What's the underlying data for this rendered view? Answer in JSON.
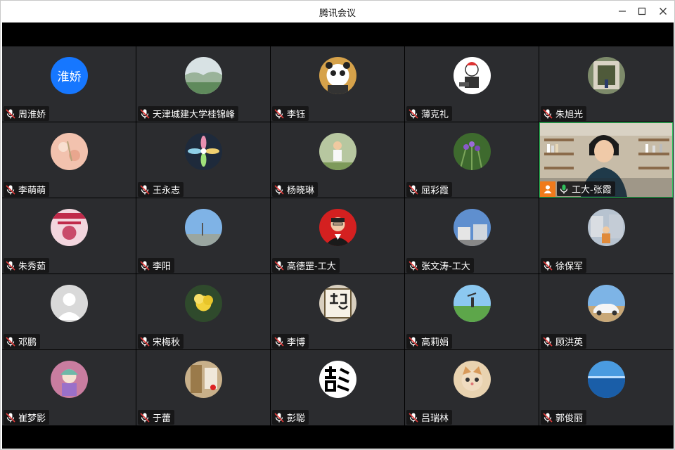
{
  "window": {
    "title": "腾讯会议",
    "minimize": "—",
    "maximize": "☐",
    "close": "✕"
  },
  "participants": [
    {
      "name": "周淮娇",
      "avatar": "text",
      "avatar_text": "淮娇",
      "color": "#1677ff"
    },
    {
      "name": "天津城建大学桂锦峰",
      "avatar": "landscape-lake",
      "color": "#9ab39a"
    },
    {
      "name": "李钰",
      "avatar": "kung-fu-panda",
      "color": "#d6a24a"
    },
    {
      "name": "薄克礼",
      "avatar": "cartoon-figure",
      "color": "#ffffff"
    },
    {
      "name": "朱旭光",
      "avatar": "garden-gate",
      "color": "#7d8a6a"
    },
    {
      "name": "李萌萌",
      "avatar": "floral-pink",
      "color": "#f2c2ae"
    },
    {
      "name": "王永志",
      "avatar": "flower-pattern",
      "color": "#1e2a3b"
    },
    {
      "name": "杨晓琳",
      "avatar": "child-outdoor",
      "color": "#b7c7a0"
    },
    {
      "name": "屈彩霞",
      "avatar": "purple-flowers",
      "color": "#4f7a3a"
    },
    {
      "name": "工大-张霞",
      "avatar": "video",
      "color": "#3a3632",
      "active": true,
      "host": true
    },
    {
      "name": "朱秀茹",
      "avatar": "poster-red",
      "color": "#c94b6a"
    },
    {
      "name": "李阳",
      "avatar": "sky-city",
      "color": "#7fb3e6"
    },
    {
      "name": "高德罡-工大",
      "avatar": "portrait-red",
      "color": "#d42020"
    },
    {
      "name": "张文涛-工大",
      "avatar": "campus-building",
      "color": "#5f8fcf"
    },
    {
      "name": "徐保军",
      "avatar": "person-orange",
      "color": "#e08a3a"
    },
    {
      "name": "邓鹏",
      "avatar": "default-user",
      "color": "#d9d9d9"
    },
    {
      "name": "宋梅秋",
      "avatar": "yellow-flower",
      "color": "#2f4a2c"
    },
    {
      "name": "李博",
      "avatar": "calligraphy-jing",
      "color": "#e9e4d8"
    },
    {
      "name": "高莉娟",
      "avatar": "grassland-person",
      "color": "#5da64a"
    },
    {
      "name": "顾洪英",
      "avatar": "white-car",
      "color": "#c9b08a"
    },
    {
      "name": "崔梦影",
      "avatar": "cartoon-girl",
      "color": "#c97da0"
    },
    {
      "name": "于蕾",
      "avatar": "window-room",
      "color": "#c8b08a"
    },
    {
      "name": "彭聪",
      "avatar": "calligraphy-peng",
      "color": "#000000"
    },
    {
      "name": "吕瑞林",
      "avatar": "kitten",
      "color": "#e8c9a0"
    },
    {
      "name": "郭俊丽",
      "avatar": "ocean",
      "color": "#1f6fb8"
    }
  ]
}
